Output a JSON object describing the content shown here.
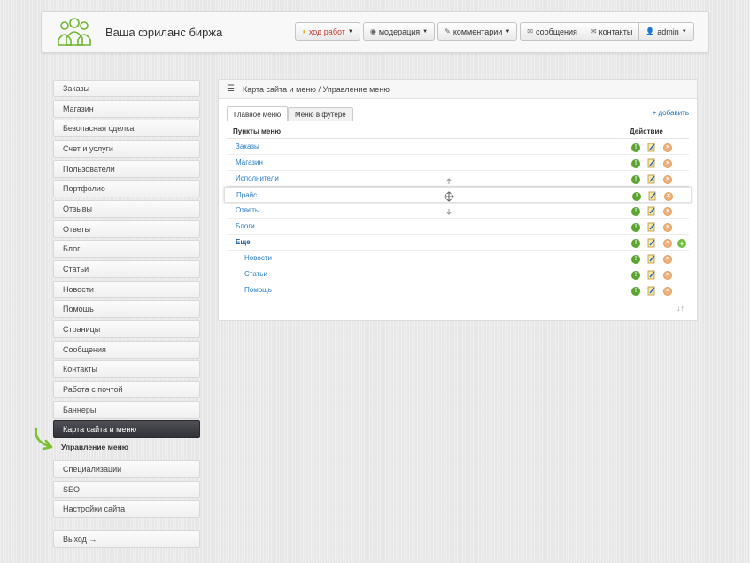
{
  "header": {
    "brand": "Ваша фриланс биржа",
    "nav": {
      "progress": "ход работ",
      "moderation": "модерация",
      "comments": "комментарии",
      "messages": "сообщения",
      "contacts": "контакты",
      "user": "admin"
    }
  },
  "sidebar": {
    "items": [
      {
        "label": "Заказы"
      },
      {
        "label": "Магазин"
      },
      {
        "label": "Безопасная сделка"
      },
      {
        "label": "Счет и услуги"
      },
      {
        "label": "Пользователи"
      },
      {
        "label": "Портфолио"
      },
      {
        "label": "Отзывы"
      },
      {
        "label": "Ответы"
      },
      {
        "label": "Блог"
      },
      {
        "label": "Статьи"
      },
      {
        "label": "Новости"
      },
      {
        "label": "Помощь"
      },
      {
        "label": "Страницы"
      },
      {
        "label": "Сообщения"
      },
      {
        "label": "Контакты"
      },
      {
        "label": "Работа с почтой"
      },
      {
        "label": "Баннеры"
      },
      {
        "label": "Карта сайта и меню"
      },
      {
        "label": "Специализации"
      },
      {
        "label": "SEO"
      },
      {
        "label": "Настройки сайта"
      }
    ],
    "active_index": 17,
    "subitem": "Управление меню",
    "logout": "Выход →"
  },
  "main": {
    "breadcrumb": "Карта сайта и меню / Управление меню",
    "tabs": [
      {
        "label": "Главное меню"
      },
      {
        "label": "Меню в футере"
      }
    ],
    "add_link": "+ добавить",
    "columns": {
      "items": "Пункты меню",
      "action": "Действие"
    },
    "rows": [
      {
        "label": "Заказы"
      },
      {
        "label": "Магазин"
      },
      {
        "label": "Исполнители"
      },
      {
        "label": "Прайс"
      },
      {
        "label": "Ответы"
      },
      {
        "label": "Блоги"
      },
      {
        "label": "Еще"
      },
      {
        "label": "Новости"
      },
      {
        "label": "Статьи"
      },
      {
        "label": "Помощь"
      }
    ]
  },
  "colors": {
    "accent": "#2a7cc7",
    "active_sidebar": "#3a3c41",
    "arrow": "#7cc12e"
  }
}
